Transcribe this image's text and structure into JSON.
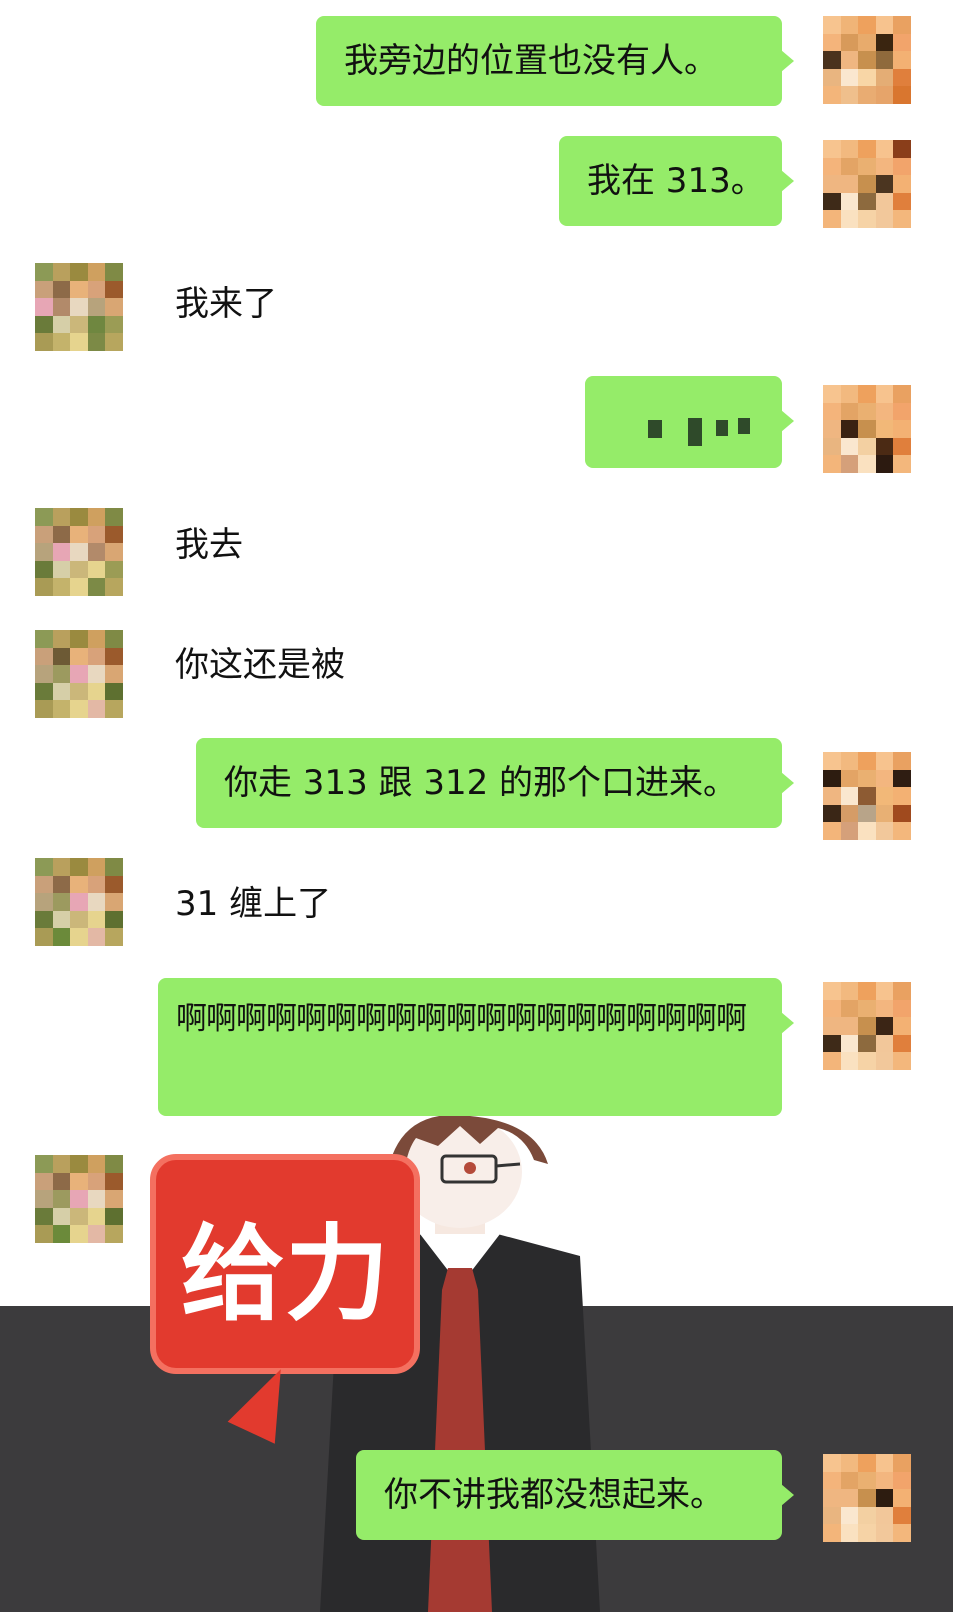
{
  "messages": [
    {
      "side": "right",
      "text": "我旁边的位置也没有人。"
    },
    {
      "side": "right",
      "text": "我在 313。"
    },
    {
      "side": "left",
      "text": "我来了"
    },
    {
      "side": "right",
      "text": ""
    },
    {
      "side": "left",
      "text": "我去"
    },
    {
      "side": "left",
      "text": "你这还是被"
    },
    {
      "side": "right",
      "text": "你走 313 跟 312 的那个口进来。"
    },
    {
      "side": "left",
      "text": "31 缠上了"
    },
    {
      "side": "right",
      "text": "啊啊啊啊啊啊啊啊啊啊啊啊啊啊啊啊啊啊啊"
    },
    {
      "side": "left",
      "sticker": "给力"
    },
    {
      "side": "right",
      "text": "你不讲我都没想起来。"
    }
  ],
  "colors": {
    "bubble_green": "#95ec69",
    "sticker_red": "#e23a2e",
    "background": "#ffffff"
  },
  "icons": {
    "avatar": "pixelated-avatar"
  }
}
